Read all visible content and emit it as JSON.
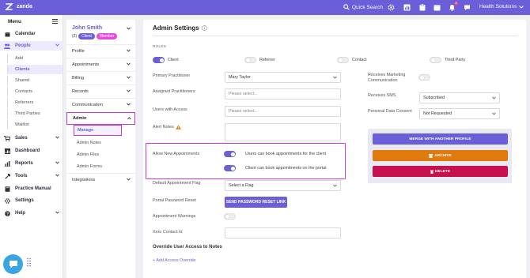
{
  "topbar": {
    "logo_text": "zanda",
    "search_label": "Quick Search",
    "account_label": "Health Solutions",
    "notification_count": "3",
    "icons": [
      "search-icon",
      "gear-icon",
      "chart-icon",
      "clipboard-icon",
      "calendar-icon",
      "bell-icon",
      "chat-icon"
    ],
    "accent": "#6a5fd8"
  },
  "sidebar": {
    "menu_label": "Menu",
    "items": [
      {
        "label": "Calendar"
      },
      {
        "label": "People"
      },
      {
        "label": "Sales"
      },
      {
        "label": "Dashboard"
      },
      {
        "label": "Reports"
      },
      {
        "label": "Tools"
      },
      {
        "label": "Practice Manual"
      },
      {
        "label": "Settings"
      },
      {
        "label": "Help"
      }
    ],
    "people_sub": [
      "Add",
      "Clients",
      "Shared",
      "Contacts",
      "Referrers",
      "Third Parties",
      "Waitlist"
    ]
  },
  "profile_panel": {
    "name": "John Smith",
    "count": "(2)",
    "badges": [
      "Client",
      "Member"
    ],
    "sections": [
      "Profile",
      "Appointments",
      "Billing",
      "Records",
      "Communication",
      "Admin",
      "Integrations"
    ],
    "admin_sub": [
      "Manage",
      "Admin Notes",
      "Admin Files",
      "Admin Forms"
    ]
  },
  "admin": {
    "title": "Admin Settings",
    "roles_heading": "ROLES",
    "roles": [
      {
        "label": "Client",
        "on": true
      },
      {
        "label": "Referrer",
        "on": false
      },
      {
        "label": "Contact",
        "on": false
      },
      {
        "label": "Third Party",
        "on": false
      }
    ],
    "primary_practitioner_label": "Primary Practitioner",
    "primary_practitioner_value": "Mary Taylor",
    "assigned_practitioners_label": "Assigned Practitioners",
    "assigned_practitioners_placeholder": "Please select...",
    "users_with_access_label": "Users with Access",
    "users_with_access_placeholder": "Please select...",
    "alert_notes_label": "Alert Notes",
    "allow_new_appointments_label": "Allow New Appointments",
    "appt_toggle_1": "Users can book appointments for the client",
    "appt_toggle_2": "Client can book appointments on the portal",
    "default_flag_label": "Default Appointment Flag",
    "default_flag_placeholder": "Select a Flag",
    "portal_password_label": "Portal Password Reset",
    "portal_password_button": "SEND PASSWORD RESET LINK",
    "appointment_warnings_label": "Appointment Warnings",
    "xero_contact_label": "Xero Contact Id",
    "override_heading": "Override User Access to Notes",
    "add_override_link": "+ Add Access Override",
    "receives_marketing_label": "Receives Marketing Communication",
    "receives_sms_label": "Receives SMS",
    "receives_sms_value": "Subscribed",
    "personal_data_label": "Personal Data Consent",
    "personal_data_value": "Not Requested",
    "merge_button": "MERGE WITH ANOTHER PROFILE",
    "archive_button": "ARCHIVE",
    "delete_button": "DELETE",
    "colors": {
      "merge": "#6a5fd8",
      "archive": "#e07a0e",
      "delete": "#c8104e",
      "highlight": "#c43ad8"
    }
  }
}
